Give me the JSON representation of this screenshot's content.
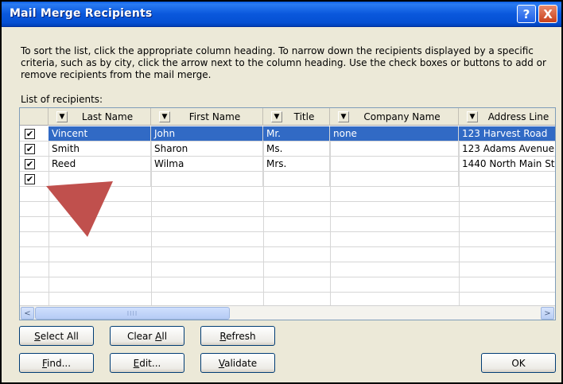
{
  "window": {
    "title": "Mail Merge Recipients",
    "help_glyph": "?",
    "close_glyph": "X"
  },
  "instructions": "To sort the list, click the appropriate column heading.  To narrow down the recipients displayed by a specific criteria, such as by city, click the arrow next to the column heading.  Use the check boxes or buttons to add or remove recipients from the mail merge.",
  "list_label": "List of recipients:",
  "columns": [
    "Last Name",
    "First Name",
    "Title",
    "Company Name",
    "Address Line"
  ],
  "rows": [
    {
      "checked": true,
      "selected": true,
      "cells": [
        "Vincent",
        "John",
        "Mr.",
        "none",
        "123 Harvest Road"
      ]
    },
    {
      "checked": true,
      "selected": false,
      "cells": [
        "Smith",
        "Sharon",
        "Ms.",
        "",
        "123 Adams Avenue"
      ]
    },
    {
      "checked": true,
      "selected": false,
      "cells": [
        "Reed",
        "Wilma",
        "Mrs.",
        "",
        "1440 North Main St"
      ]
    },
    {
      "checked": true,
      "selected": false,
      "cells": [
        "",
        "",
        "",
        "",
        ""
      ]
    }
  ],
  "scrollbar": {
    "left": "<",
    "right": ">",
    "grip": "IIII"
  },
  "buttons": {
    "select_all": {
      "pre": "",
      "key": "S",
      "post": "elect All"
    },
    "clear_all": {
      "pre": "Clear ",
      "key": "A",
      "post": "ll"
    },
    "refresh": {
      "pre": "",
      "key": "R",
      "post": "efresh"
    },
    "find": {
      "pre": "",
      "key": "F",
      "post": "ind..."
    },
    "edit": {
      "pre": "",
      "key": "E",
      "post": "dit..."
    },
    "validate": {
      "pre": "",
      "key": "V",
      "post": "alidate"
    },
    "ok": "OK"
  },
  "check_glyph": "✔",
  "dropdown_glyph": "▼",
  "colors": {
    "titlebar": "#0a58dc",
    "selection": "#316ac5",
    "pointer": "#c0504d"
  }
}
